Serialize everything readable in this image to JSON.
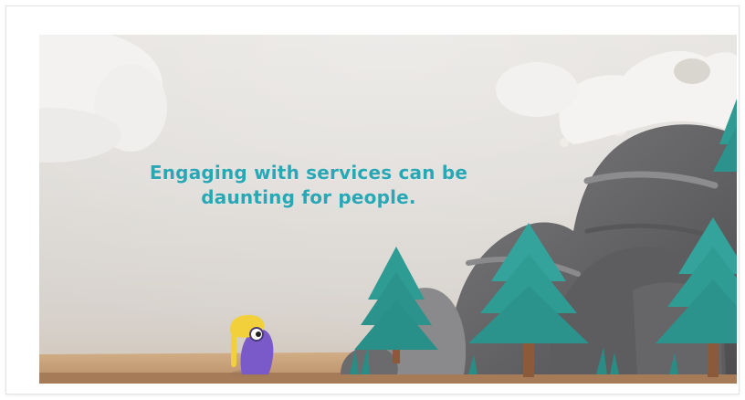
{
  "caption": {
    "line1": "Engaging with services can be",
    "line2": "daunting for people."
  },
  "colors": {
    "caption": "#2aa7b5",
    "sky": "#e4e1dd",
    "ground": "#c9a27e",
    "rock": "#6f6e70",
    "snow": "#f3f1ee",
    "tree": "#2f9c94",
    "character_body": "#7a5ac8",
    "character_hat": "#f2d03c"
  }
}
